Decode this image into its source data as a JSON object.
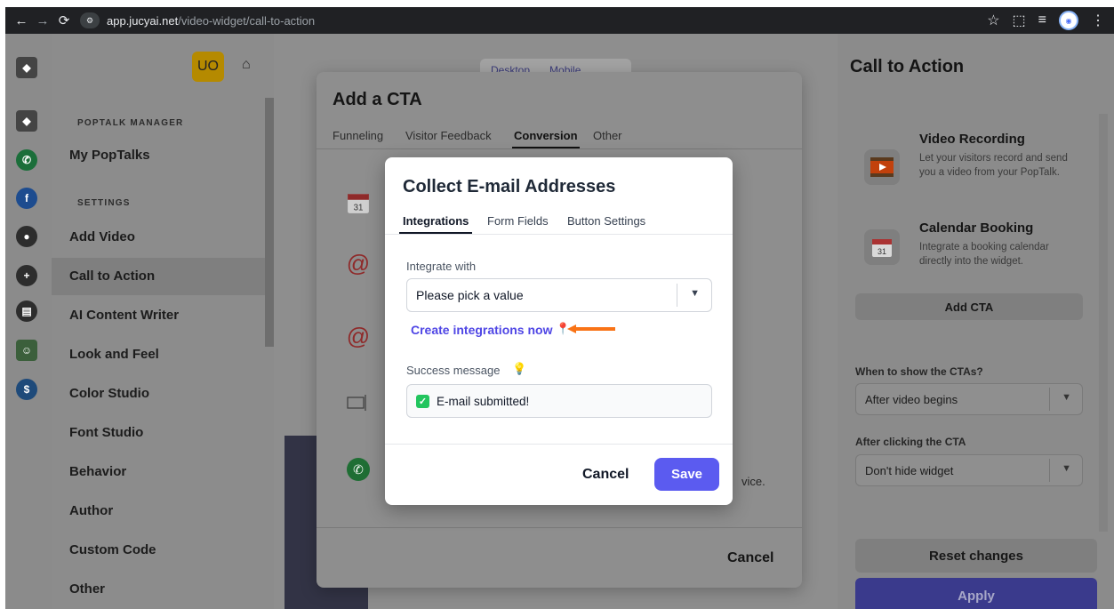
{
  "browser": {
    "url_host": "app.jucyai.net",
    "url_path": "/video-widget/call-to-action"
  },
  "sidebar": {
    "badge": "UO",
    "section_poptalk": "POPTALK MANAGER",
    "my_poptalks": "My PopTalks",
    "section_settings": "SETTINGS",
    "items": [
      "Add Video",
      "Call to Action",
      "AI Content Writer",
      "Look and Feel",
      "Color Studio",
      "Font Studio",
      "Behavior",
      "Author",
      "Custom Code",
      "Other"
    ]
  },
  "center": {
    "device_desktop": "Desktop",
    "device_mobile": "Mobile"
  },
  "cta_modal": {
    "title": "Add a CTA",
    "tabs": [
      "Funneling",
      "Visitor Feedback",
      "Conversion",
      "Other"
    ],
    "active_tab": "Conversion",
    "partial_text": "vice.",
    "cancel": "Cancel"
  },
  "email_modal": {
    "title": "Collect E-mail Addresses",
    "tabs": [
      "Integrations",
      "Form Fields",
      "Button Settings"
    ],
    "active_tab": "Integrations",
    "integrate_label": "Integrate with",
    "integrate_value": "Please pick a value",
    "create_link": "Create integrations now",
    "success_label": "Success message",
    "success_value": "E-mail submitted!",
    "cancel": "Cancel",
    "save": "Save",
    "arrow_color": "#f97316",
    "save_color": "#5b5bf0"
  },
  "right_panel": {
    "title": "Call to Action",
    "cards": [
      {
        "title": "Video Recording",
        "desc": "Let your visitors record and send you a video from your PopTalk."
      },
      {
        "title": "Calendar Booking",
        "desc": "Integrate a booking calendar directly into the widget."
      }
    ],
    "add_cta": "Add CTA",
    "when_label": "When to show the CTAs?",
    "when_value": "After video begins",
    "after_label": "After clicking the CTA",
    "after_value": "Don't hide widget",
    "reset": "Reset changes",
    "apply": "Apply"
  }
}
